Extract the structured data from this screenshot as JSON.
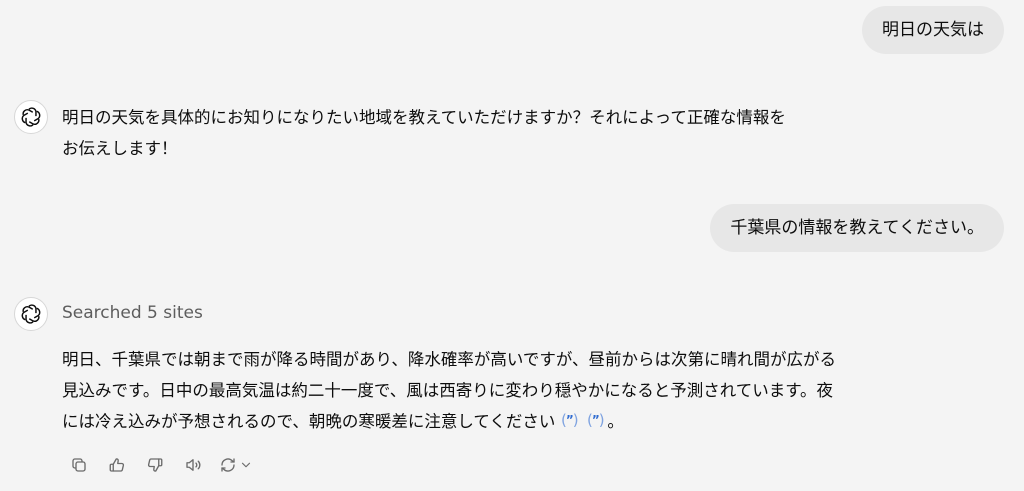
{
  "conversation": {
    "user_message_1": "明日の天気は",
    "assistant_message_1": {
      "lines": [
        "明日の天気を具体的にお知りになりたい地域を教えていただけますか？それによって正確な情報を",
        "お伝えします！"
      ]
    },
    "user_message_2": "千葉県の情報を教えてください。",
    "assistant_message_2": {
      "status": "Searched 5 sites",
      "lines": [
        "明日、千葉県では朝まで雨が降る時間があり、降水確率が高いですが、昼前からは次第に晴れ間が広がる",
        "見込みです。日中の最高気温は約二十一度で、風は西寄りに変わり穏やかになると予測されています。夜",
        "には冷え込みが予想されるので、朝晩の寒暖差に注意してください"
      ],
      "end_punct": "。",
      "citations": [
        "citation",
        "citation"
      ]
    }
  },
  "actions": {
    "icons": [
      "copy-icon",
      "thumbs-up-icon",
      "thumbs-down-icon",
      "read-aloud-icon",
      "regenerate-icon",
      "chevron-down-icon"
    ]
  },
  "colors": {
    "background": "#f4f4f4",
    "user_bubble": "#e7e7e7",
    "citation": "#2f6bd0",
    "muted_text": "#5d5d5d"
  }
}
